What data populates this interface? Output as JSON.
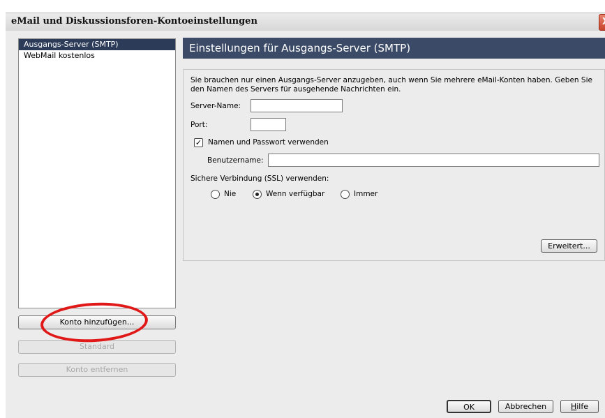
{
  "window": {
    "title": "eMail und Diskussionsforen-Kontoeinstellungen",
    "close_label": "X"
  },
  "accounts": {
    "items": [
      {
        "label": "Ausgangs-Server (SMTP)"
      },
      {
        "label": "WebMail kostenlos"
      }
    ],
    "selected_index": 0
  },
  "side_buttons": {
    "add": "Konto hinzufügen...",
    "default": "Standard",
    "remove": "Konto entfernen"
  },
  "panel": {
    "title": "Einstellungen für Ausgangs-Server (SMTP)",
    "description": "Sie brauchen nur einen Ausgangs-Server anzugeben, auch wenn Sie mehrere eMail-Konten haben. Geben Sie den Namen des Servers für ausgehende Nachrichten ein.",
    "server_name_label": "Server-Name:",
    "server_name_value": "",
    "port_label": "Port:",
    "port_value": "",
    "use_auth_label": "Namen und Passwort verwenden",
    "use_auth_checked": true,
    "username_label": "Benutzername:",
    "username_value": "",
    "ssl_label": "Sichere Verbindung (SSL) verwenden:",
    "ssl_options": [
      "Nie",
      "Wenn verfügbar",
      "Immer"
    ],
    "ssl_selected": "Wenn verfügbar",
    "advanced_button": "Erweitert..."
  },
  "footer": {
    "ok": "OK",
    "cancel": "Abbrechen",
    "help": "Hilfe"
  },
  "colors": {
    "selection": "#2c3b57",
    "header": "#3b4a66",
    "annotation": "#e01818"
  }
}
